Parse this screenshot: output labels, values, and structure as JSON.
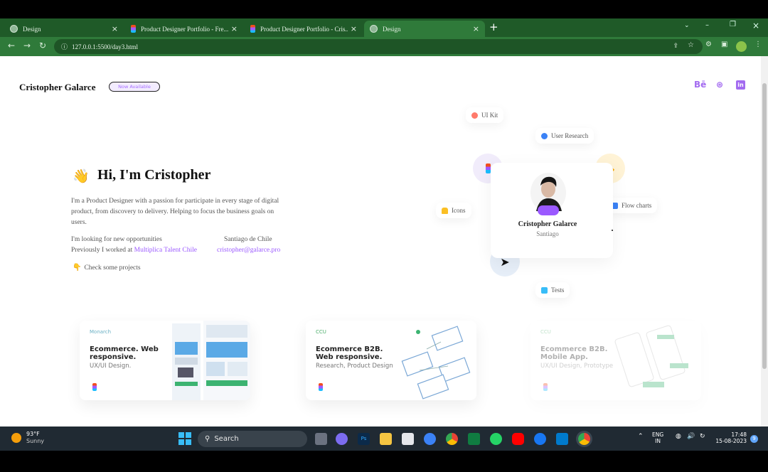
{
  "tabs": [
    {
      "title": "Design",
      "icon": "globe-icon",
      "active": false
    },
    {
      "title": "Product Designer Portfolio - Fre...",
      "icon": "figma-icon",
      "active": false
    },
    {
      "title": "Product Designer Portfolio - Cris...",
      "icon": "figma-icon",
      "active": false
    },
    {
      "title": "Design",
      "icon": "globe-icon",
      "active": true
    }
  ],
  "new_tab": "+",
  "address": "127.0.0.1:5500/day3.html",
  "header": {
    "brand": "Cristopher Galarce",
    "badge": "Now Available",
    "socials": [
      "Bē",
      "⊛",
      "in"
    ]
  },
  "hero": {
    "wave": "👋",
    "greeting": "Hi, I'm Cristopher",
    "bio": "I'm a Product Designer with a passion for participate in every stage of digital product, from discovery to delivery. Helping to focus the business goals on users.",
    "looking": "I'm looking for new opportunities",
    "previously_prefix": "Previously I worked at ",
    "previously_company": "Multiplica Talent Chile",
    "location": "Santiago de Chile",
    "email": "cristopher@galarce.pro",
    "cta_icon": "👇",
    "cta": "Check some projects"
  },
  "skills": {
    "ui_kit": "UI Kit",
    "user_research": "User Research",
    "icons": "Icons",
    "flow_charts": "Flow charts",
    "tests": "Tests"
  },
  "profile": {
    "name": "Cristopher Galarce",
    "city": "Santiago"
  },
  "projects": [
    {
      "brand": "Monarch",
      "title": "Ecommerce. Web responsive.",
      "subtitle": "UX/UI Design."
    },
    {
      "brand": "CCU",
      "title": "Ecommerce B2B. Web responsive.",
      "subtitle": "Research, Product Design"
    },
    {
      "brand": "CCU",
      "title": "Ecommerce B2B. Mobile App.",
      "subtitle": "UX/UI Design, Prototype"
    }
  ],
  "taskbar": {
    "weather_temp": "93°F",
    "weather_text": "Sunny",
    "search": "Search",
    "lang1": "ENG",
    "lang2": "IN",
    "time": "17:48",
    "date": "15-08-2023",
    "notifications": "9"
  },
  "colors": {
    "chrome_green": "#2f7a3a",
    "accent_purple": "#9b59ff"
  }
}
